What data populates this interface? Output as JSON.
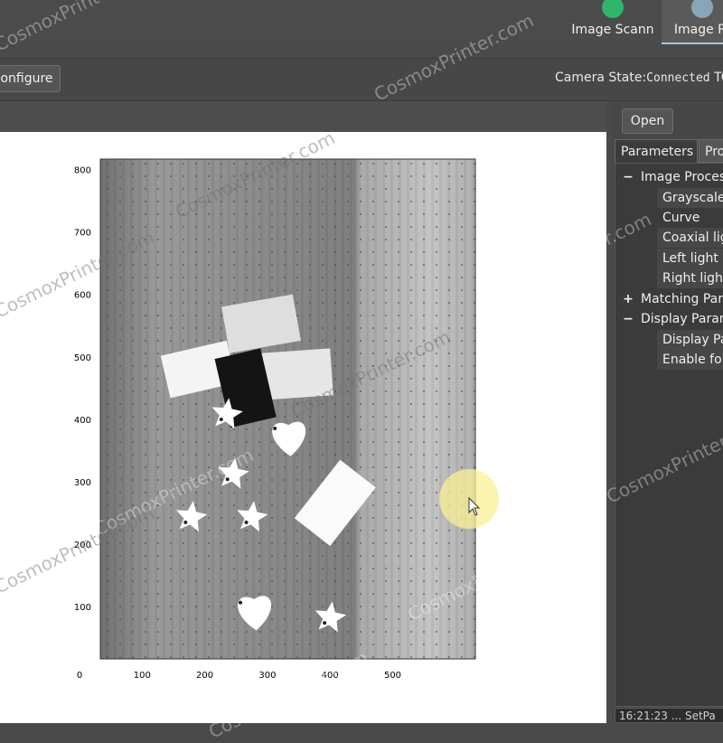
{
  "tabs": [
    {
      "label": "Image Scann",
      "icon": "shield-check-icon"
    },
    {
      "label": "Image Pr",
      "icon": "gear-icon"
    }
  ],
  "toolbar": {
    "configure_label": "onfigure"
  },
  "camera": {
    "label": "Camera State:",
    "value": "Connected",
    "suffix": "TC"
  },
  "panel": {
    "open_label": "Open",
    "tabs": [
      "Parameters",
      "Pro"
    ],
    "tree": [
      {
        "label": "Image Proces",
        "sign": "−",
        "children": [
          "Grayscale",
          "Curve",
          "Coaxial lig",
          "Left light s",
          "Right light"
        ]
      },
      {
        "label": "Matching Par",
        "sign": "+",
        "children": []
      },
      {
        "label": "Display Param",
        "sign": "−",
        "children": [
          "Display Pa",
          "Enable fol"
        ]
      }
    ],
    "log": "16:21:23 ... SetPa"
  },
  "watermark": "CosmoxPrinter.com",
  "chart_data": {
    "type": "image",
    "xticks": [
      0,
      100,
      200,
      300,
      400,
      500
    ],
    "yticks": [
      100,
      200,
      300,
      400,
      500,
      600,
      700,
      800
    ],
    "xlim": [
      0,
      600
    ],
    "ylim": [
      0,
      820
    ],
    "objects": [
      {
        "kind": "card",
        "x": 190,
        "y": 480,
        "w": 75,
        "h": 48,
        "angle": -13,
        "fill": "#f4f4f4"
      },
      {
        "kind": "card",
        "x": 290,
        "y": 553,
        "w": 80,
        "h": 52,
        "angle": -10,
        "fill": "#dedede"
      },
      {
        "kind": "card",
        "x": 345,
        "y": 472,
        "w": 80,
        "h": 52,
        "angle": -4,
        "fill": "#e6e6e6"
      },
      {
        "kind": "card",
        "x": 265,
        "y": 450,
        "w": 52,
        "h": 78,
        "angle": -13,
        "fill": "#141414"
      },
      {
        "kind": "card",
        "x": 408,
        "y": 266,
        "w": 50,
        "h": 82,
        "angle": 38,
        "fill": "#fafafa"
      },
      {
        "kind": "star",
        "x": 235,
        "y": 408,
        "r": 26
      },
      {
        "kind": "star",
        "x": 245,
        "y": 312,
        "r": 26
      },
      {
        "kind": "star",
        "x": 178,
        "y": 243,
        "r": 26
      },
      {
        "kind": "star",
        "x": 275,
        "y": 243,
        "r": 26
      },
      {
        "kind": "star",
        "x": 400,
        "y": 82,
        "r": 26
      },
      {
        "kind": "heart",
        "x": 335,
        "y": 372,
        "r": 34
      },
      {
        "kind": "heart",
        "x": 280,
        "y": 93,
        "r": 34
      }
    ]
  },
  "colors": {
    "accent": "#9dc7e6",
    "tab_icon_1": "#2fb56c",
    "tab_icon_2": "#8aa4b8",
    "cursor_highlight": "#f8ee90"
  }
}
